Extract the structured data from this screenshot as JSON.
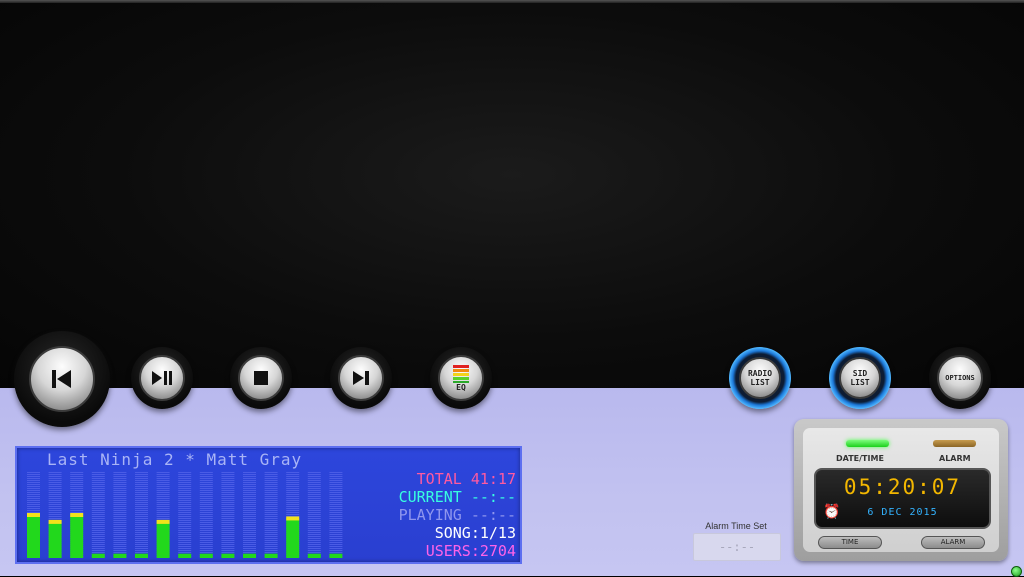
{
  "player": {
    "buttons": {
      "prev": "previous",
      "play_pause": "play-pause",
      "stop": "stop",
      "next": "next",
      "eq_label": "EQ",
      "radio_label": "RADIO\nLIST",
      "sid_label": "SID\nLIST",
      "options_label": "OPTIONS"
    },
    "display": {
      "title": "Last Ninja 2 * Matt Gray",
      "total": "TOTAL 41:17",
      "current": "CURRENT --:--",
      "playing": "PLAYING --:--",
      "song": "SONG:1/13",
      "users": "USERS:2704",
      "colors": {
        "total": "#ff5aa0",
        "current": "#38ffe0",
        "playing": "#8f96ee",
        "song": "#ffffff",
        "users": "#ff63e8"
      }
    },
    "vu_levels": [
      0.5,
      0.42,
      0.5,
      0.05,
      0.05,
      0.05,
      0.42,
      0.05,
      0.05,
      0.05,
      0.05,
      0.05,
      0.46,
      0.05,
      0.05
    ]
  },
  "alarm_set": {
    "label": "Alarm Time Set",
    "value": "--:--"
  },
  "clock": {
    "datetime_label": "DATE/TIME",
    "alarm_label": "ALARM",
    "time": "05:20:07",
    "date": "6 DEC 2015",
    "time_button": "TIME",
    "alarm_button": "ALARM"
  }
}
